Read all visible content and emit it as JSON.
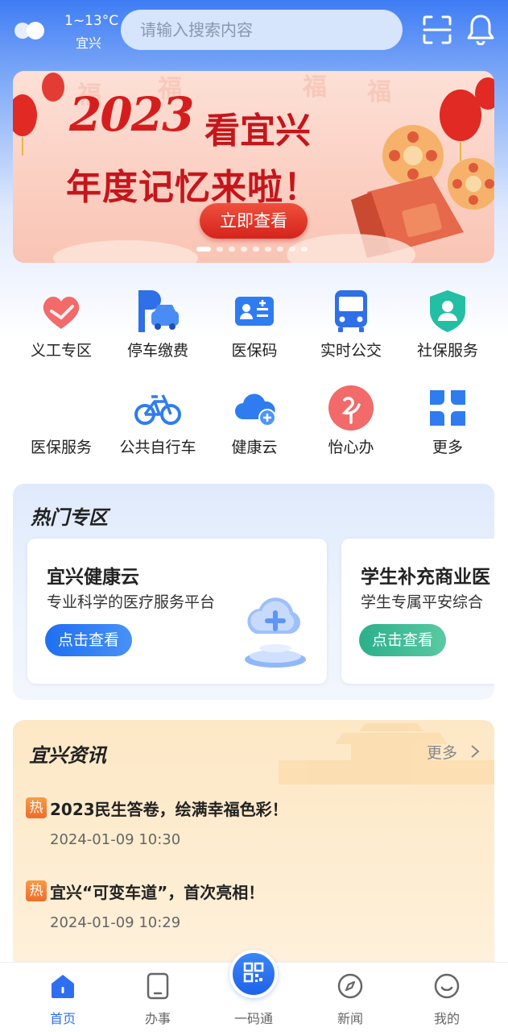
{
  "header": {
    "weather_temp": "1~13°C",
    "weather_city": "宜兴",
    "weather_icon": "cloud-icon",
    "search_placeholder": "请输入搜索内容",
    "scan_icon": "scan-icon",
    "notification_icon": "bell-icon"
  },
  "banner": {
    "year": "2023",
    "subtitle": "看宜兴",
    "title": "年度记忆来啦！",
    "button": "立即查看",
    "slide_count": 9,
    "active_slide": 1
  },
  "services": [
    {
      "label": "义工专区",
      "icon": "heart-hand-icon"
    },
    {
      "label": "停车缴费",
      "icon": "parking-car-icon"
    },
    {
      "label": "医保码",
      "icon": "medical-card-icon"
    },
    {
      "label": "实时公交",
      "icon": "bus-icon"
    },
    {
      "label": "社保服务",
      "icon": "shield-person-icon"
    },
    {
      "label": "医保服务",
      "icon": "medical-service-icon"
    },
    {
      "label": "公共自行车",
      "icon": "bicycle-icon"
    },
    {
      "label": "健康云",
      "icon": "health-cloud-icon"
    },
    {
      "label": "怡心办",
      "icon": "yixin-icon"
    },
    {
      "label": "更多",
      "icon": "more-grid-icon"
    }
  ],
  "hot_zone": {
    "title": "热门专区",
    "cards": [
      {
        "title": "宜兴健康云",
        "desc": "专业科学的医疗服务平台",
        "button": "点击查看"
      },
      {
        "title": "学生补充商业医",
        "desc": "学生专属平安综合",
        "button": "点击查看"
      }
    ]
  },
  "news": {
    "title": "宜兴资讯",
    "more": "更多",
    "items": [
      {
        "badge": "热",
        "text": "2023民生答卷，绘满幸福色彩！",
        "time": "2024-01-09 10:30"
      },
      {
        "badge": "热",
        "text": "宜兴“可变车道”，首次亮相！",
        "time": "2024-01-09 10:29"
      }
    ]
  },
  "bottom_nav": [
    {
      "label": "首页",
      "icon": "home-icon",
      "active": true
    },
    {
      "label": "办事",
      "icon": "tablet-icon",
      "active": false
    },
    {
      "label": "一码通",
      "icon": "qr-code-icon",
      "active": false
    },
    {
      "label": "新闻",
      "icon": "compass-icon",
      "active": false
    },
    {
      "label": "我的",
      "icon": "smile-icon",
      "active": false
    }
  ],
  "colors": {
    "primary": "#2e6ff2",
    "banner_red": "#c4161c",
    "hot_badge": "#ef6c2a"
  }
}
